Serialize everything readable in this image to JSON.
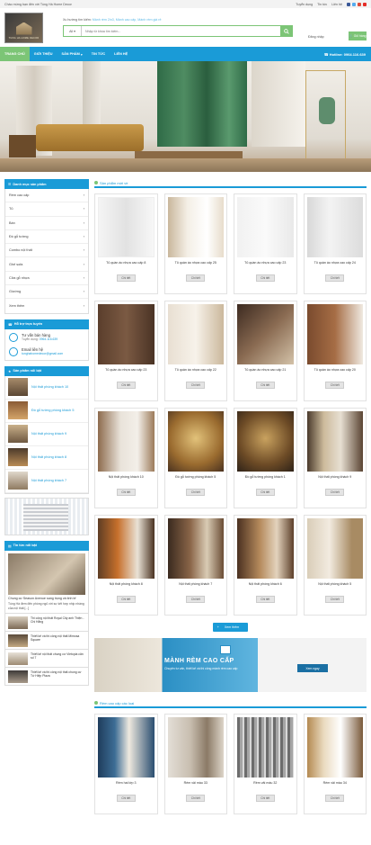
{
  "topbar": {
    "welcome": "Chào mừng bạn đến với Tùng Hà Home Decor",
    "links": [
      "Tuyển dụng",
      "Tin tức",
      "Liên hệ"
    ]
  },
  "header": {
    "logo_text": "TUNG HA HOME DECOR",
    "suggest_label": "Xu hướng tìm kiếm: ",
    "suggest_values": "Mành rèm 2in3, Mành cao cấp, Mành rèm giá rẻ",
    "category_select": "All",
    "search_placeholder": "Nhập từ khóa tìm kiếm...",
    "login_label": "Đăng nhập",
    "cart_label": "Giỏ hàng"
  },
  "nav": {
    "items": [
      "TRANG CHỦ",
      "GIỚI THIỆU",
      "SẢN PHẨM",
      "TIN TỨC",
      "LIÊN HỆ"
    ],
    "hotline": "Hotline: 0964.116.639"
  },
  "sidebar": {
    "categories_title": "Danh mục sản phẩm",
    "categories": [
      "Rèm cao cấp",
      "Tủ",
      "Bàn",
      "Đồ gỗ tường",
      "Combo nội thất",
      "Ghế sofa",
      "Cửa gỗ nhựa",
      "Giường",
      "Xem thêm"
    ],
    "support_title": "Hỗ trợ trực tuyến",
    "support": [
      {
        "name": "Tư vấn bán hàng",
        "label": "Tuyển dụng:",
        "value": "0964.116.639"
      },
      {
        "name": "Email liên hệ",
        "label": "",
        "value": "tunghahomedecor@gmail.com"
      }
    ],
    "featured_title": "Sản phẩm nổi bật",
    "featured": [
      "Nội thất phòng khách 10",
      "Đồ gỗ tường phòng khách 5",
      "Nội thất phòng khách 9",
      "Nội thất phòng khách 8",
      "Nội thất phòng khách 7"
    ],
    "news_title": "Tin tức nổi bật",
    "news_big_title": "Chung cư Season Avenue sang trọng và tinh tế",
    "news_big_desc": "Tùng Hà đem đến phòng ngủ với sự kết hợp nhịp nhàng của nội thất [...]",
    "news_items": [
      "Thi công nội thất Royal City anh Thiện - Chị Hằng",
      "Thiết kế và thi công nội thất Mimosa Square",
      "Thiết kế nội thất chung cư Vietopia căn số 7",
      "Thiết kế và thi công nội thất chung cư Tứ Hiệp Plaza"
    ]
  },
  "products_section": {
    "title": "Sản phẩm mới về",
    "detail_label": "Chi tiết",
    "items": [
      {
        "name": "Tủ quần áo nhựa cao cấp 8"
      },
      {
        "name": "Tủ quần áo nhựa cao cấp 25"
      },
      {
        "name": "Tủ quần áo nhựa cao cấp 23"
      },
      {
        "name": "Tủ quần áo nhựa cao cấp 24"
      },
      {
        "name": "Tủ quần áo nhựa cao cấp 23"
      },
      {
        "name": "Tủ quần áo nhựa cao cấp 22"
      },
      {
        "name": "Tủ quần áo nhựa cao cấp 21"
      },
      {
        "name": "Tủ quần áo nhựa cao cấp 20"
      },
      {
        "name": "Nội thất phòng khách 10"
      },
      {
        "name": "Đồ gỗ tường phòng khách 5"
      },
      {
        "name": "Đồ gỗ tường phòng khách 1"
      },
      {
        "name": "Nội thất phòng khách 9"
      },
      {
        "name": "Nội thất phòng khách 8"
      },
      {
        "name": "Nội thất phòng khách 7"
      },
      {
        "name": "Nội thất phòng khách 6"
      },
      {
        "name": "Nội thất phòng khách 5"
      }
    ],
    "see_more": "Xem thêm"
  },
  "mid_banner": {
    "headline": "MÀNH RÈM CAO CẤP",
    "sub": "Chuyên tư vấn, thiết kế và thi công mành rèm cao cấp",
    "button": "Xem ngay"
  },
  "curtain_section": {
    "title": "Rèm cao cấp các loại",
    "detail_label": "Chi tiết",
    "items": [
      {
        "name": "Rèm hai lớp 3"
      },
      {
        "name": "Rèm vải màu 33"
      },
      {
        "name": "Rèm vải màu 32"
      },
      {
        "name": "Rèm vải màu 34"
      }
    ]
  },
  "colors": {
    "primary_blue": "#1a9bd7",
    "accent_green": "#7cc576"
  }
}
